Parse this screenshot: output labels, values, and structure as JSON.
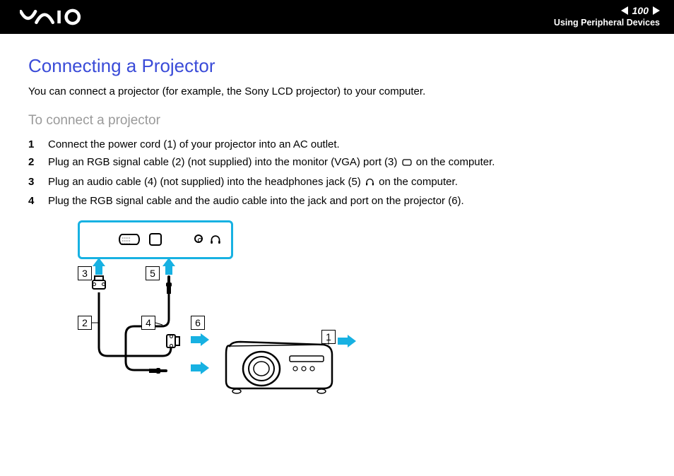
{
  "header": {
    "page_number": "100",
    "section": "Using Peripheral Devices"
  },
  "content": {
    "title": "Connecting a Projector",
    "intro": "You can connect a projector (for example, the Sony LCD projector) to your computer.",
    "subtitle": "To connect a projector",
    "steps": [
      {
        "num": "1",
        "text_before": "Connect the power cord (1) of your projector into an AC outlet.",
        "icon": null,
        "text_after": ""
      },
      {
        "num": "2",
        "text_before": "Plug an RGB signal cable (2) (not supplied) into the monitor (VGA) port (3) ",
        "icon": "monitor",
        "text_after": " on the computer."
      },
      {
        "num": "3",
        "text_before": "Plug an audio cable (4) (not supplied) into the headphones jack (5) ",
        "icon": "headphones",
        "text_after": " on the computer."
      },
      {
        "num": "4",
        "text_before": "Plug the RGB signal cable and the audio cable into the jack and port on the projector (6).",
        "icon": null,
        "text_after": ""
      }
    ]
  },
  "diagram": {
    "callouts": {
      "c1": "1",
      "c2": "2",
      "c3": "3",
      "c4": "4",
      "c5": "5",
      "c6": "6"
    }
  }
}
